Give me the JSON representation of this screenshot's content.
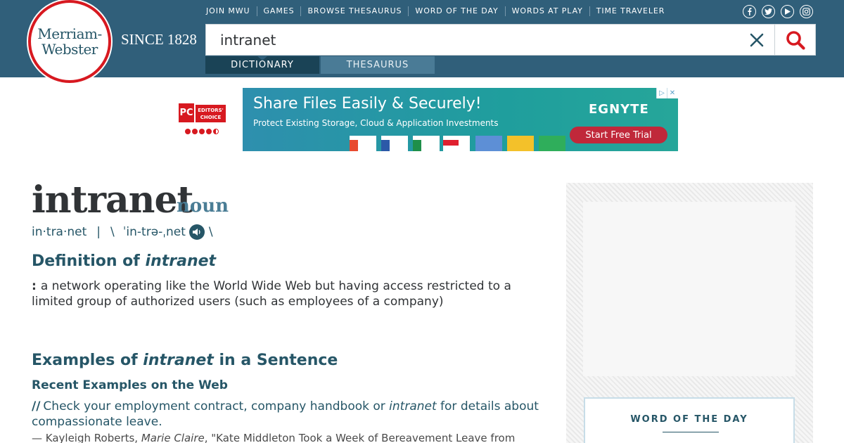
{
  "header": {
    "logo_lines": [
      "Merriam-",
      "Webster"
    ],
    "since": "SINCE 1828",
    "nav": [
      "JOIN MWU",
      "GAMES",
      "BROWSE THESAURUS",
      "WORD OF THE DAY",
      "WORDS AT PLAY",
      "TIME TRAVELER"
    ],
    "social_icons": [
      "facebook-icon",
      "twitter-icon",
      "youtube-icon",
      "instagram-icon"
    ],
    "search": {
      "value": "intranet"
    },
    "tabs": {
      "dictionary": "DICTIONARY",
      "thesaurus": "THESAURUS"
    }
  },
  "ad": {
    "badge_top": "PC",
    "badge_label": "EDITORS' CHOICE",
    "headline": "Share Files Easily & Securely!",
    "subline": "Protect Existing Storage, Cloud & Application Investments",
    "brand": "EGNYTE",
    "cta": "Start Free Trial"
  },
  "entry": {
    "headword": "intranet",
    "part_of_speech": "noun",
    "syllables": "in·tra·net",
    "pipe": "|",
    "backslash_open": "\\",
    "pronunciation": "ˈin-trə-ˌnet",
    "backslash_close": "\\",
    "definition_heading_prefix": "Definition of ",
    "definition_heading_word": "intranet",
    "definition_colon": ":",
    "definition_text": "a network operating like the World Wide Web but having access restricted to a limited group of authorized users (such as employees of a company)",
    "examples_heading_prefix": "Examples of ",
    "examples_heading_word": "intranet",
    "examples_heading_suffix": " in a Sentence",
    "recent_examples_heading": "Recent Examples on the Web",
    "example_mark": "//",
    "example_before": "Check your employment contract, company handbook or ",
    "example_word": "intranet",
    "example_after": " for details about compassionate leave.",
    "attribution_prefix": "— Kayleigh Roberts, ",
    "attribution_source": "Marie Claire",
    "attribution_suffix": ", \"Kate Middleton Took a Week of Bereavement Leave from"
  },
  "sidebar": {
    "word_of_the_day_label": "WORD OF THE DAY"
  }
}
